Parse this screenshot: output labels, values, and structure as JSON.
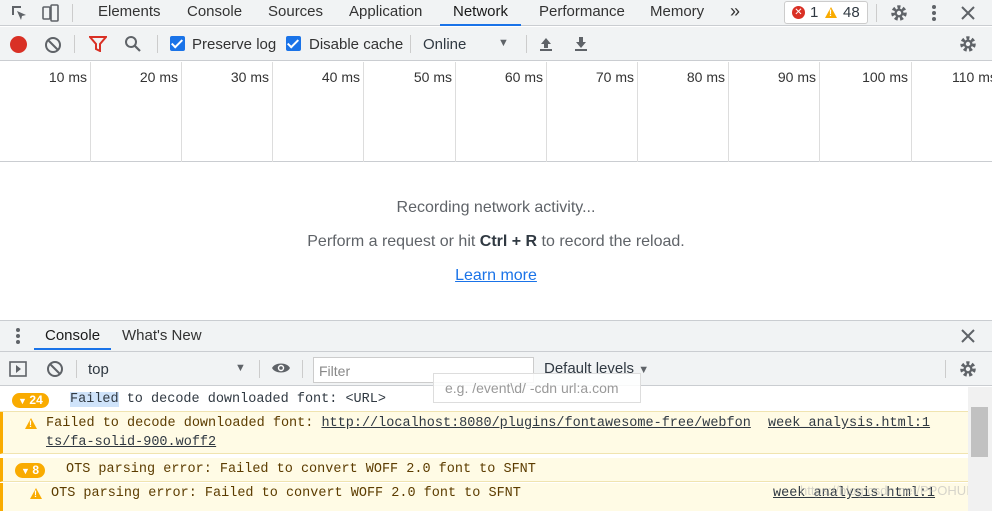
{
  "devtools_tabs": [
    "Elements",
    "Console",
    "Sources",
    "Application",
    "Network",
    "Performance",
    "Memory"
  ],
  "more_tabs_glyph": "»",
  "counts": {
    "errors": "1",
    "warnings": "48"
  },
  "network_toolbar": {
    "preserve_log": "Preserve log",
    "preserve_log_checked": true,
    "disable_cache": "Disable cache",
    "disable_cache_checked": true,
    "throttling": "Online"
  },
  "timeline_ticks": [
    "10 ms",
    "20 ms",
    "30 ms",
    "40 ms",
    "50 ms",
    "60 ms",
    "70 ms",
    "80 ms",
    "90 ms",
    "100 ms",
    "110 ms"
  ],
  "empty_state": {
    "line1": "Recording network activity...",
    "line2_prefix": "Perform a request or hit ",
    "line2_shortcut": "Ctrl + R",
    "line2_suffix": " to record the reload.",
    "learn_more": "Learn more"
  },
  "drawer": {
    "tabs": [
      "Console",
      "What's New"
    ],
    "active_tab": "Console"
  },
  "console_toolbar": {
    "context": "top",
    "filter_placeholder": "Filter",
    "levels": "Default levels",
    "filter_hint": "e.g. /event\\d/ -cdn url:a.com"
  },
  "messages": [
    {
      "count": "24",
      "summary_highlight": "Failed",
      "summary_rest": " to decode downloaded font: <URL>",
      "detail_prefix": "Failed to decode downloaded font: ",
      "detail_link_1": "http://localhost:8080/plugins/fontawesome-free/webfon",
      "detail_link_2": "ts/fa-solid-900.woff2",
      "source": "week_analysis.html:1"
    },
    {
      "count": "8",
      "summary": "OTS parsing error: Failed to convert WOFF 2.0 font to SFNT",
      "detail": "OTS parsing error: Failed to convert WOFF 2.0 font to SFNT",
      "source": "week_analysis.html:1"
    }
  ],
  "watermark": "https://blog.csdn.net/PPOHUI",
  "colors": {
    "accent": "#1a73e8",
    "record": "#d93025",
    "warning": "#f9ab00",
    "warning_bg": "#fffbe5"
  }
}
